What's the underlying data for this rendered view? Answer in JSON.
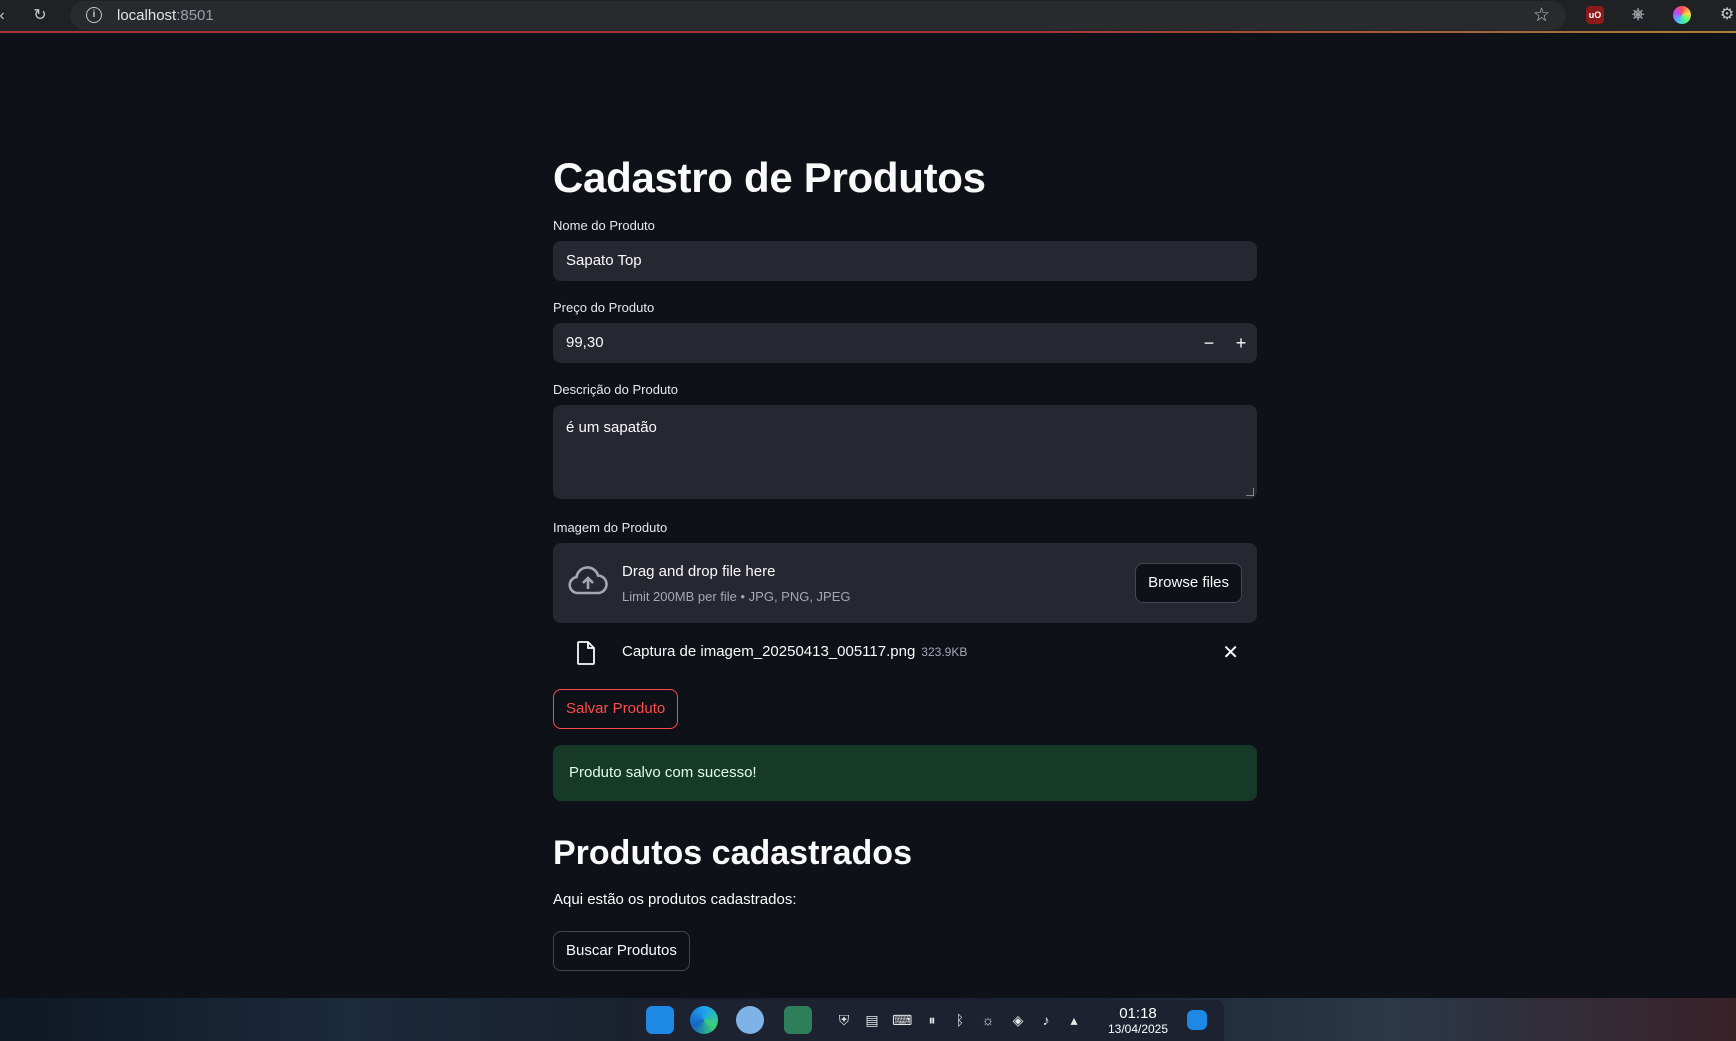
{
  "browser": {
    "url_host": "localhost",
    "url_port": ":8501",
    "extension_badge": "uO"
  },
  "form": {
    "title": "Cadastro de Produtos",
    "name_label": "Nome do Produto",
    "name_value": "Sapato Top",
    "price_label": "Preço do Produto",
    "price_value": "99,30",
    "decrement": "−",
    "increment": "+",
    "description_label": "Descrição do Produto",
    "description_value": "é um sapatão",
    "image_label": "Imagem do Produto",
    "dropzone_title": "Drag and drop file here",
    "dropzone_limit": "Limit 200MB per file • JPG, PNG, JPEG",
    "browse_label": "Browse files",
    "uploaded_file_name": "Captura de imagem_20250413_005117.png",
    "uploaded_file_size": "323.9KB",
    "save_label": "Salvar Produto",
    "success_message": "Produto salvo com sucesso!"
  },
  "list": {
    "title": "Produtos cadastrados",
    "caption": "Aqui estão os produtos cadastrados:",
    "search_label": "Buscar Produtos"
  },
  "taskbar": {
    "time": "01:18",
    "date": "13/04/2025"
  },
  "colors": {
    "background": "#0e1117",
    "input": "#262730",
    "accent": "#ff4b4b",
    "success_bg": "#173928"
  }
}
